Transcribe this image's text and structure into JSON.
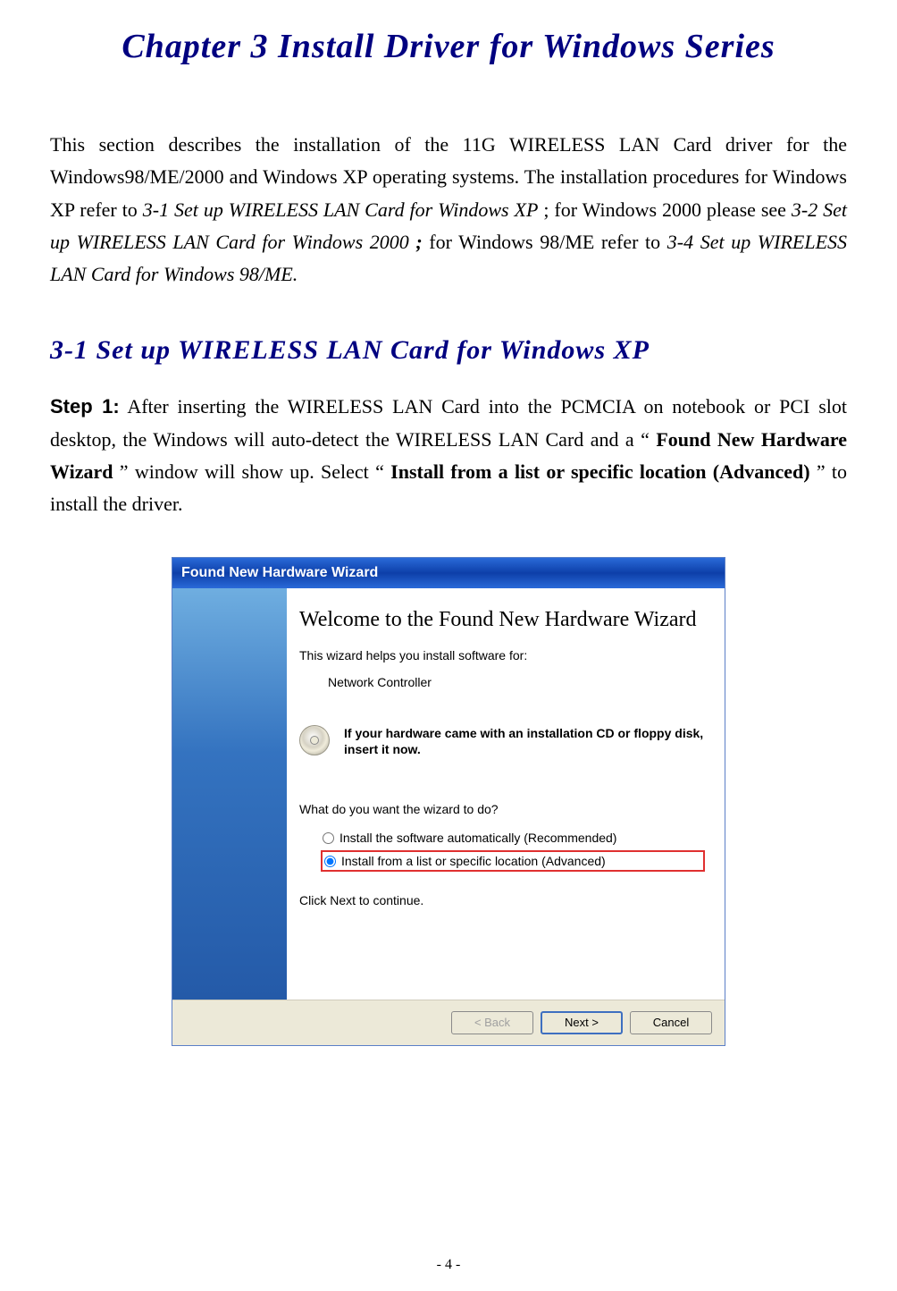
{
  "chapter_title": "Chapter 3 Install Driver for Windows Series",
  "intro": {
    "p1a": "This section describes the installation of the 11G WIRELESS LAN Card driver for the Windows98/ME/2000 and Windows XP operating systems. The installation procedures for Windows XP refer to ",
    "p1b": "3-1 Set up WIRELESS LAN Card for Windows XP",
    "p1c": "; for Windows 2000 please see ",
    "p1d": "3-2 Set up WIRELESS LAN Card for Windows 2000",
    "p1e": "; ",
    "p1f": "for Windows 98/ME refer to ",
    "p1g": "3-4 Set up WIRELESS LAN Card for Windows 98/ME."
  },
  "section_title": "3-1 Set up WIRELESS LAN Card for Windows XP",
  "step": {
    "label": "Step 1:",
    "t1": " After inserting the WIRELESS LAN Card into the PCMCIA on notebook or PCI slot desktop, the Windows will auto-detect the WIRELESS LAN Card and a “",
    "b1": "Found New Hardware Wizard",
    "t2": "” window will show up. Select “",
    "b2": "Install from a list or specific location (Advanced)",
    "t3": "” to install the driver."
  },
  "wizard": {
    "titlebar": "Found New Hardware Wizard",
    "heading": "Welcome to the Found New Hardware Wizard",
    "help": "This wizard helps you install software for:",
    "device": "Network Controller",
    "cd_text": "If your hardware came with an installation CD or floppy disk, insert it now.",
    "question": "What do you want the wizard to do?",
    "option1": "Install the software automatically (Recommended)",
    "option2": "Install from a list or specific location (Advanced)",
    "continue": "Click Next to continue.",
    "buttons": {
      "back": "< Back",
      "next": "Next >",
      "cancel": "Cancel"
    }
  },
  "page_number": "- 4 -"
}
